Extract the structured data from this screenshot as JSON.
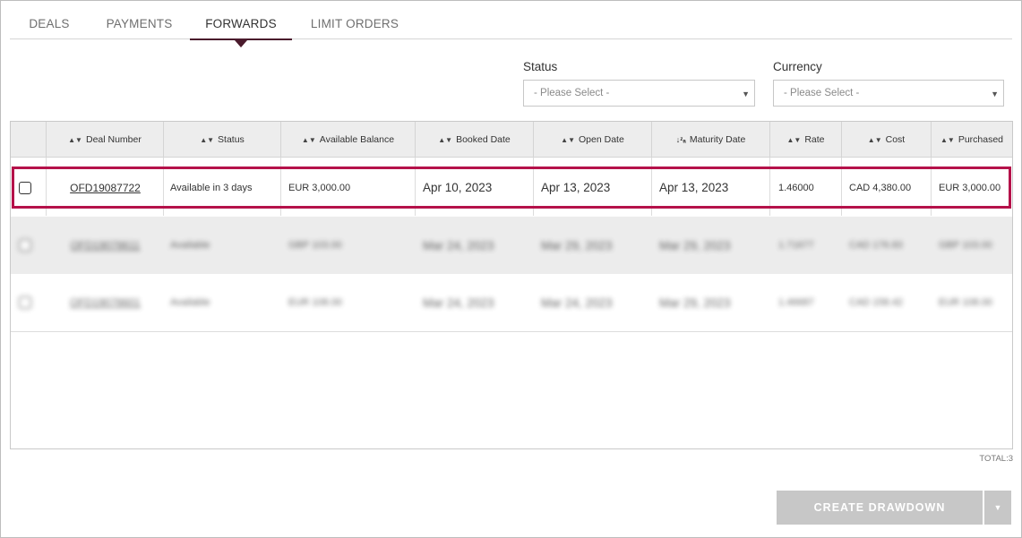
{
  "tabs": [
    {
      "label": "DEALS"
    },
    {
      "label": "PAYMENTS"
    },
    {
      "label": "FORWARDS",
      "active": true
    },
    {
      "label": "LIMIT ORDERS"
    }
  ],
  "filters": {
    "status": {
      "label": "Status",
      "placeholder": "- Please Select -"
    },
    "currency": {
      "label": "Currency",
      "placeholder": "- Please Select -"
    }
  },
  "table": {
    "columns": [
      "Deal Number",
      "Status",
      "Available Balance",
      "Booked Date",
      "Open Date",
      "Maturity Date",
      "Rate",
      "Cost",
      "Purchased"
    ],
    "sorted_column": "Maturity Date",
    "rows": [
      {
        "deal_number": "OFD19087722",
        "status": "Available in 3 days",
        "available_balance": "EUR 3,000.00",
        "booked_date": "Apr 10, 2023",
        "open_date": "Apr 13, 2023",
        "maturity_date": "Apr 13, 2023",
        "rate": "1.46000",
        "cost": "CAD 4,380.00",
        "purchased": "EUR 3,000.00"
      },
      {
        "deal_number": "OFD19078611",
        "status": "Available",
        "available_balance": "GBP 103.00",
        "booked_date": "Mar 24, 2023",
        "open_date": "Mar 29, 2023",
        "maturity_date": "Mar 29, 2023",
        "rate": "1.71677",
        "cost": "CAD 176.83",
        "purchased": "GBP 103.00"
      },
      {
        "deal_number": "OFD19078601",
        "status": "Available",
        "available_balance": "EUR 108.00",
        "booked_date": "Mar 24, 2023",
        "open_date": "Mar 24, 2023",
        "maturity_date": "Mar 29, 2023",
        "rate": "1.46687",
        "cost": "CAD 158.42",
        "purchased": "EUR 108.00"
      }
    ]
  },
  "total_label": "TOTAL:3",
  "actions": {
    "create_drawdown": "CREATE DRAWDOWN"
  },
  "colors": {
    "accent": "#4a1a2c",
    "highlight": "#b5124a",
    "button_disabled": "#c7c7c7"
  }
}
